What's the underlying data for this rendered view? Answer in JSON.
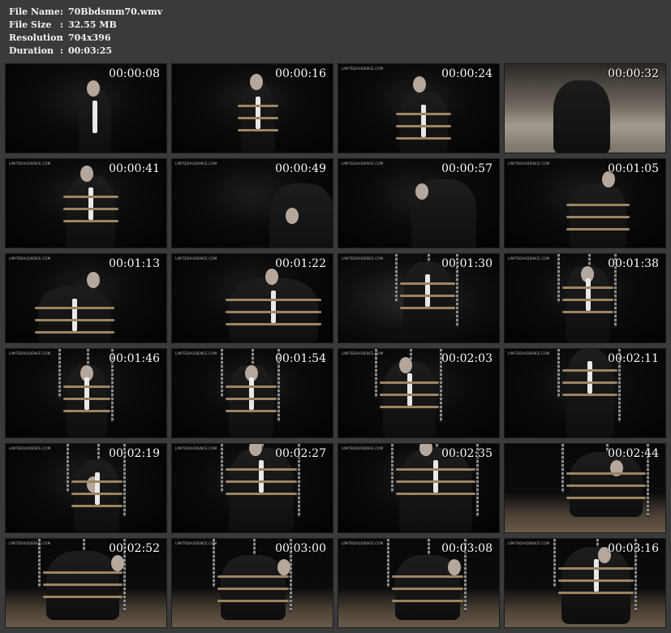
{
  "file_info": [
    {
      "key": "File Name",
      "sep": ":",
      "value": "70Bbdsmm70.wmv"
    },
    {
      "key": "File Size",
      "sep": ":",
      "value": "32.55 MB"
    },
    {
      "key": "Resolution",
      "sep": ":",
      "value": "704x396"
    },
    {
      "key": "Duration",
      "sep": ":",
      "value": "00:03:25"
    }
  ],
  "watermark": "LIMITEDAUDIENCE.COM",
  "thumbnails": [
    {
      "time": "00:00:08",
      "scene": "dark",
      "wm": false
    },
    {
      "time": "00:00:16",
      "scene": "dark",
      "wm": false
    },
    {
      "time": "00:00:24",
      "scene": "dark",
      "wm": true
    },
    {
      "time": "00:00:32",
      "scene": "bright",
      "wm": false
    },
    {
      "time": "00:00:41",
      "scene": "dark",
      "wm": true
    },
    {
      "time": "00:00:49",
      "scene": "dark",
      "wm": true
    },
    {
      "time": "00:00:57",
      "scene": "dark",
      "wm": true
    },
    {
      "time": "00:01:05",
      "scene": "dark",
      "wm": true
    },
    {
      "time": "00:01:13",
      "scene": "dark",
      "wm": true
    },
    {
      "time": "00:01:22",
      "scene": "dark",
      "wm": true
    },
    {
      "time": "00:01:30",
      "scene": "mid",
      "wm": true
    },
    {
      "time": "00:01:38",
      "scene": "dark",
      "wm": true
    },
    {
      "time": "00:01:46",
      "scene": "dark",
      "wm": true
    },
    {
      "time": "00:01:54",
      "scene": "dark",
      "wm": true
    },
    {
      "time": "00:02:03",
      "scene": "dark",
      "wm": true
    },
    {
      "time": "00:02:11",
      "scene": "dark",
      "wm": true
    },
    {
      "time": "00:02:19",
      "scene": "dark",
      "wm": true
    },
    {
      "time": "00:02:27",
      "scene": "dark",
      "wm": true
    },
    {
      "time": "00:02:35",
      "scene": "dark",
      "wm": true
    },
    {
      "time": "00:02:44",
      "scene": "floor",
      "wm": false
    },
    {
      "time": "00:02:52",
      "scene": "floor",
      "wm": true
    },
    {
      "time": "00:03:00",
      "scene": "floor",
      "wm": true
    },
    {
      "time": "00:03:08",
      "scene": "floor",
      "wm": true
    },
    {
      "time": "00:03:16",
      "scene": "floor",
      "wm": true
    }
  ]
}
